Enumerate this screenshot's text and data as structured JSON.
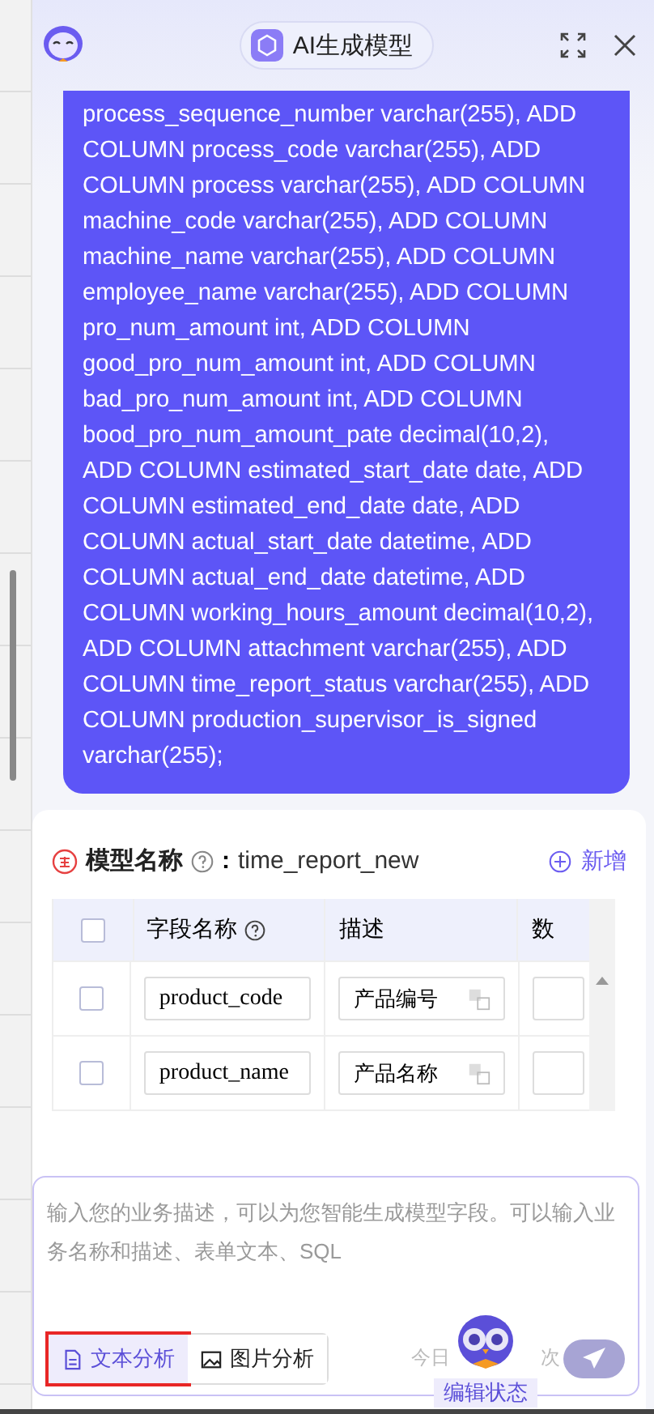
{
  "header": {
    "title": "AI生成模型"
  },
  "message": {
    "lines": [
      "process_sequence_number varchar(255), ADD",
      "COLUMN process_code varchar(255), ADD",
      "COLUMN process varchar(255), ADD COLUMN",
      "machine_code varchar(255), ADD COLUMN",
      "machine_name varchar(255), ADD COLUMN",
      "employee_name varchar(255), ADD COLUMN",
      "pro_num_amount int, ADD COLUMN",
      "good_pro_num_amount int, ADD COLUMN",
      "bad_pro_num_amount int, ADD COLUMN",
      "bood_pro_num_amount_pate decimal(10,2),",
      "ADD COLUMN estimated_start_date date, ADD",
      "COLUMN estimated_end_date date, ADD",
      "COLUMN actual_start_date datetime, ADD",
      "COLUMN actual_end_date datetime, ADD",
      "COLUMN working_hours_amount decimal(10,2),",
      "ADD COLUMN attachment varchar(255), ADD",
      "COLUMN time_report_status varchar(255), ADD",
      "COLUMN production_supervisor_is_signed",
      "varchar(255);"
    ]
  },
  "model": {
    "label": "模型名称",
    "separator": ":",
    "name": "time_report_new",
    "add": "新增",
    "columns": [
      "字段名称",
      "描述",
      "数"
    ],
    "select_all_checked": false,
    "rows": [
      {
        "checked": false,
        "field": "product_code",
        "desc": "产品编号"
      },
      {
        "checked": false,
        "field": "product_name",
        "desc": "产品名称"
      }
    ]
  },
  "input": {
    "placeholder": "输入您的业务描述，可以为您智能生成模型字段。可以输入业务名称和描述、表单文本、SQL",
    "tools": [
      {
        "kind": "text",
        "label": "文本分析",
        "selected": true,
        "highlight_box": true
      },
      {
        "kind": "image",
        "label": "图片分析",
        "selected": false,
        "highlight_box": false
      }
    ],
    "quota_before": "今日",
    "quota_after": "次",
    "mascot_label": "编辑状态"
  }
}
